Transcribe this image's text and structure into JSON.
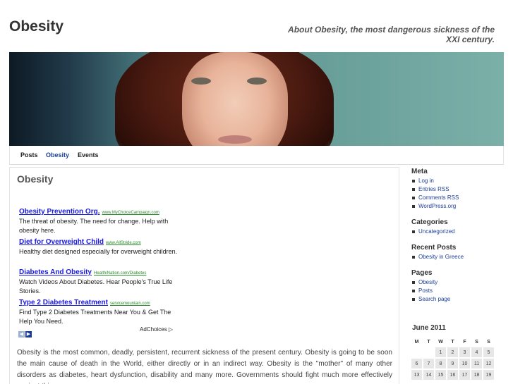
{
  "header": {
    "site_title": "Obesity",
    "site_description": "About Obesity, the most dangerous sickness of the XXI century."
  },
  "nav": {
    "items": [
      {
        "label": "Posts"
      },
      {
        "label": "Obesity"
      },
      {
        "label": "Events"
      }
    ]
  },
  "post": {
    "title": "Obesity",
    "body": "Obesity is the most common, deadly, persistent, recurrent sickness of the present century. Obesity is going to be soon the main cause of death in the World, either directly or in an indirect way. Obesity is the \"mother\" of many other disorders as diabetes, heart dysfunction, disability and many more. Governments should fight much more effectively against this"
  },
  "ads": {
    "items": [
      {
        "title": "Obesity Prevention Org.",
        "url": "www.MyChoiceCampaign.com",
        "text": "The threat of obesity. The need for change. Help with obesity here."
      },
      {
        "title": "Diet for Overweight Child",
        "url": "www.AllStride.com",
        "text": "Healthy diet designed especially for overweight children."
      },
      {
        "title": "Diabetes And Obesity",
        "url": "HealthiNation.com/Diabetes",
        "text": "Watch Videos About Diabetes. Hear People's True Life Stories."
      },
      {
        "title": "Type 2 Diabetes Treatment",
        "url": "servicemountain.com",
        "text": "Find Type 2 Diabetes Treatments Near You & Get The Help You Need."
      }
    ],
    "adchoices_label": "AdChoices"
  },
  "sidebar": {
    "meta": {
      "title": "Meta",
      "items": [
        "Log in",
        "Entries RSS",
        "Comments RSS",
        "WordPress.org"
      ]
    },
    "categories": {
      "title": "Categories",
      "items": [
        "Uncategorized"
      ]
    },
    "recent_posts": {
      "title": "Recent Posts",
      "items": [
        "Obesity in Greece"
      ]
    },
    "pages": {
      "title": "Pages",
      "items": [
        "Obesity",
        "Posts",
        "Search page"
      ]
    }
  },
  "calendar": {
    "caption": "June 2011",
    "weekdays": [
      "M",
      "T",
      "W",
      "T",
      "F",
      "S",
      "S"
    ],
    "weeks": [
      [
        "",
        "",
        "1",
        "2",
        "3",
        "4",
        "5"
      ],
      [
        "6",
        "7",
        "8",
        "9",
        "10",
        "11",
        "12"
      ],
      [
        "13",
        "14",
        "15",
        "16",
        "17",
        "18",
        "19"
      ]
    ]
  },
  "colors": {
    "link": "#1a3e9a",
    "ad_title": "#1a1adf",
    "ad_url": "#2a8a2a",
    "calendar_cell": "#e7e7e7"
  }
}
